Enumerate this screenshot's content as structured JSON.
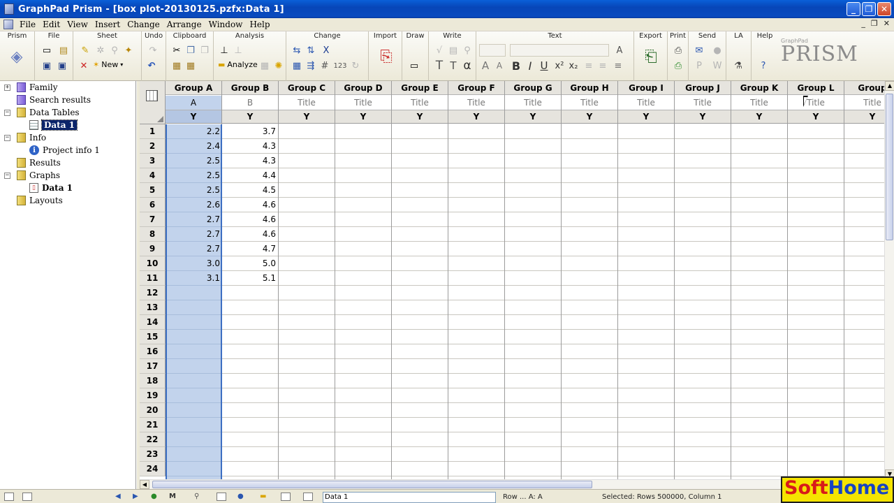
{
  "window": {
    "title": "GraphPad Prism - [box plot-20130125.pzfx:Data 1]",
    "controls": [
      "_",
      "❐",
      "✕"
    ],
    "mdi_controls": [
      "_",
      "❐",
      "✕"
    ]
  },
  "menu": [
    "File",
    "Edit",
    "View",
    "Insert",
    "Change",
    "Arrange",
    "Window",
    "Help"
  ],
  "toolbar": {
    "groups": [
      "Prism",
      "File",
      "Sheet",
      "Undo",
      "Clipboard",
      "Analysis",
      "Change",
      "Import",
      "Draw",
      "Write",
      "Text",
      "Export",
      "Print",
      "Send",
      "LA",
      "Help"
    ],
    "new_label": "New",
    "analyze_label": "Analyze",
    "logo_small": "GraphPad",
    "logo_text": "PRISM"
  },
  "navigator": {
    "items": [
      {
        "label": "Family",
        "level": 0
      },
      {
        "label": "Search results",
        "level": 0
      },
      {
        "label": "Data Tables",
        "level": 0
      },
      {
        "label": "Data 1",
        "level": 1
      },
      {
        "label": "Info",
        "level": 0
      },
      {
        "label": "Project info 1",
        "level": 1
      },
      {
        "label": "Results",
        "level": 0
      },
      {
        "label": "Graphs",
        "level": 0
      },
      {
        "label": "Data 1",
        "level": 1
      },
      {
        "label": "Layouts",
        "level": 0
      }
    ]
  },
  "grid": {
    "columns": [
      {
        "name": "Group A",
        "title": "A",
        "sub": "Y"
      },
      {
        "name": "Group B",
        "title": "B",
        "sub": "Y"
      },
      {
        "name": "Group C",
        "title": "Title",
        "sub": "Y"
      },
      {
        "name": "Group D",
        "title": "Title",
        "sub": "Y"
      },
      {
        "name": "Group E",
        "title": "Title",
        "sub": "Y"
      },
      {
        "name": "Group F",
        "title": "Title",
        "sub": "Y"
      },
      {
        "name": "Group G",
        "title": "Title",
        "sub": "Y"
      },
      {
        "name": "Group H",
        "title": "Title",
        "sub": "Y"
      },
      {
        "name": "Group I",
        "title": "Title",
        "sub": "Y"
      },
      {
        "name": "Group J",
        "title": "Title",
        "sub": "Y"
      },
      {
        "name": "Group K",
        "title": "Title",
        "sub": "Y"
      },
      {
        "name": "Group L",
        "title": "Title",
        "sub": "Y"
      },
      {
        "name": "Group",
        "title": "Title",
        "sub": "Y"
      }
    ],
    "row_numbers": [
      "1",
      "2",
      "3",
      "4",
      "5",
      "6",
      "7",
      "8",
      "9",
      "10",
      "11",
      "12",
      "13",
      "14",
      "15",
      "16",
      "17",
      "18",
      "19",
      "20",
      "21",
      "22",
      "23",
      "24"
    ],
    "group_a": [
      "2.2",
      "2.4",
      "2.5",
      "2.5",
      "2.5",
      "2.6",
      "2.7",
      "2.7",
      "2.7",
      "3.0",
      "3.1"
    ],
    "group_b": [
      "3.7",
      "4.3",
      "4.3",
      "4.4",
      "4.5",
      "4.6",
      "4.6",
      "4.6",
      "4.7",
      "5.0",
      "5.1"
    ]
  },
  "status": {
    "sheet_select": "Data 1",
    "text1": "Row ... A: A",
    "text2": "Selected: Rows 500000, Column 1"
  },
  "watermark": {
    "part1": "Soft",
    "part2": "Home"
  }
}
